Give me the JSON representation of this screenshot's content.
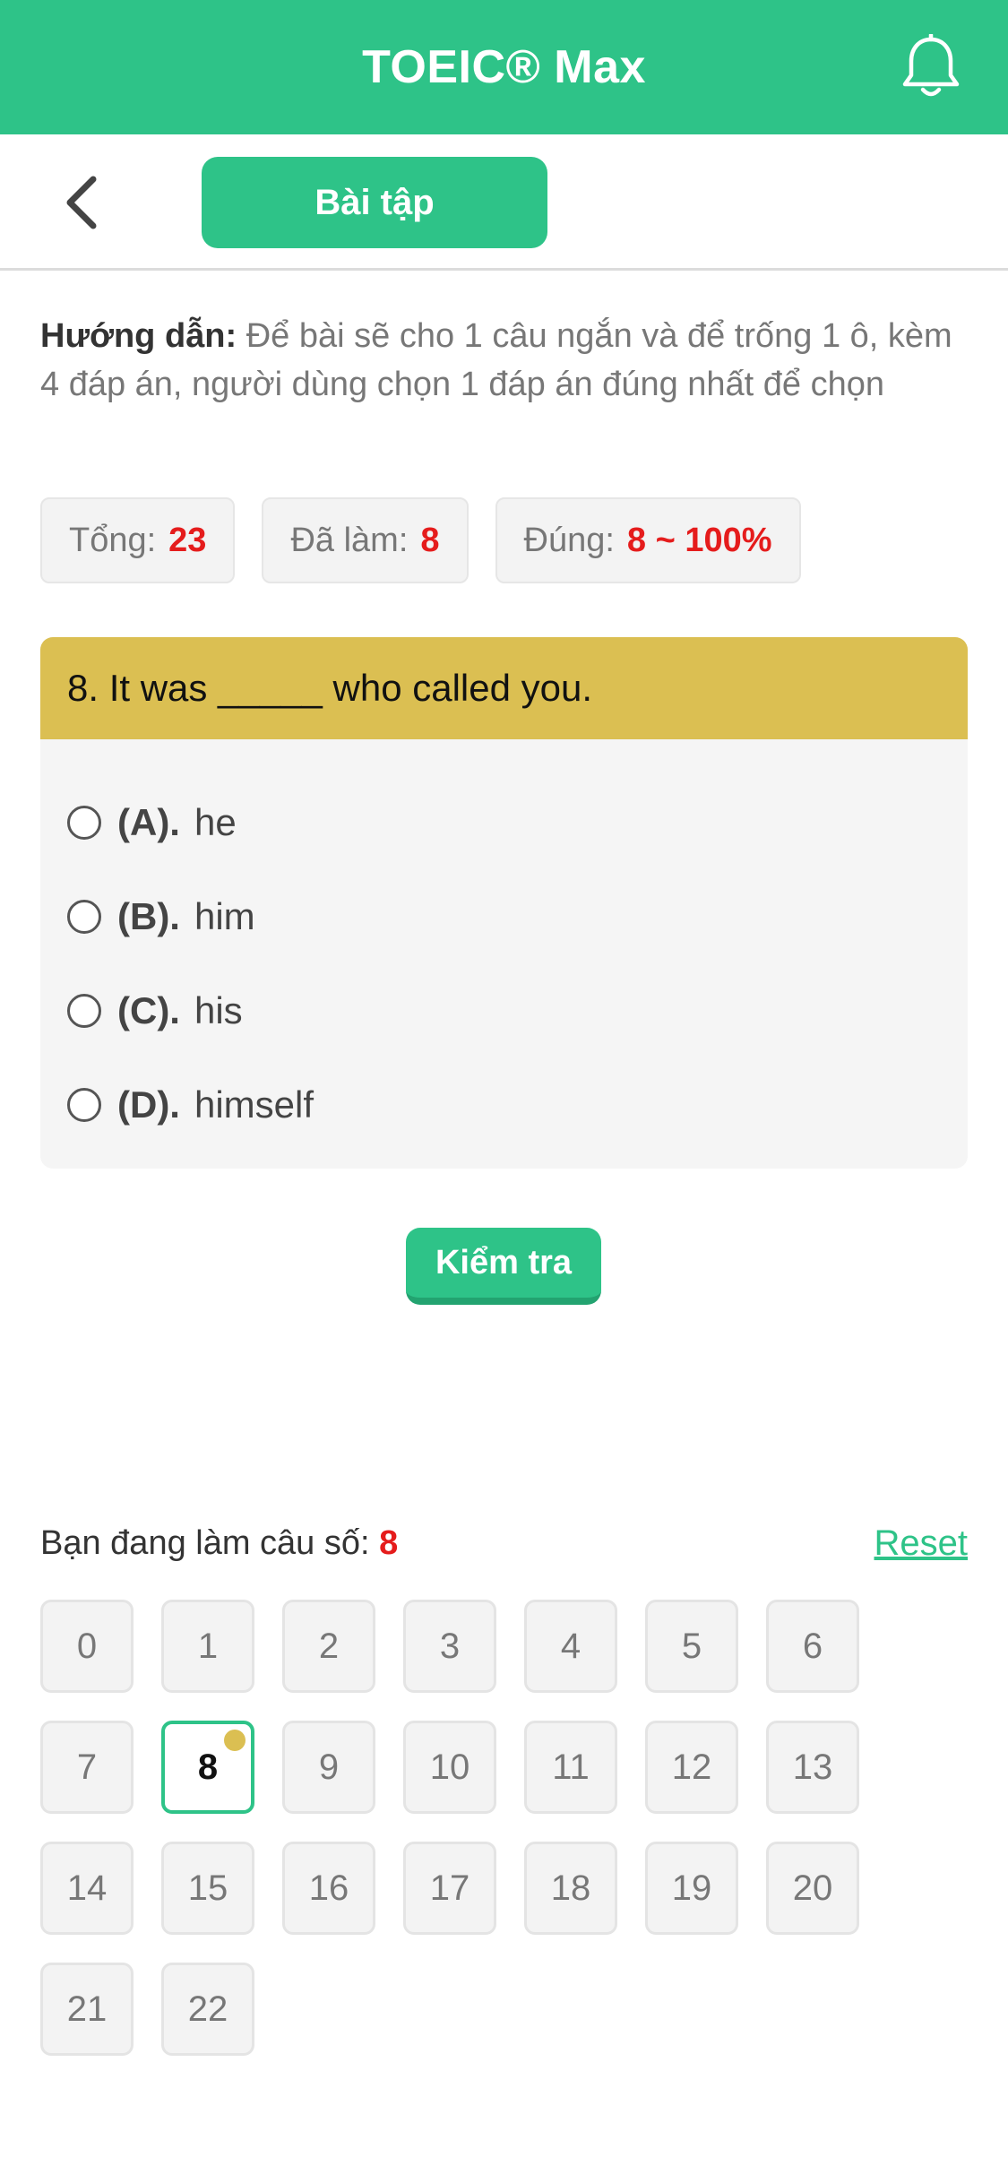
{
  "header": {
    "title": "TOEIC® Max",
    "icons": {
      "notification": "bell-icon"
    },
    "color": "#2ec388"
  },
  "subheader": {
    "back_icon": "chevron-left-icon",
    "tab_label": "Bài tập"
  },
  "instructions": {
    "label": "Hướng dẫn:",
    "text": "Để bài sẽ cho 1 câu ngắn và để trống 1 ô, kèm 4 đáp án, người dùng chọn 1 đáp án đúng nhất để chọn"
  },
  "stats": {
    "total_label": "Tổng:",
    "total_value": "23",
    "done_label": "Đã làm:",
    "done_value": "8",
    "correct_label": "Đúng:",
    "correct_value": "8 ~ 100%"
  },
  "question": {
    "text": "8. It was _____ who called you.",
    "header_color": "#dbbf52",
    "options": [
      {
        "letter": "(A).",
        "text": "he"
      },
      {
        "letter": "(B).",
        "text": "him"
      },
      {
        "letter": "(C).",
        "text": "his"
      },
      {
        "letter": "(D).",
        "text": "himself"
      }
    ]
  },
  "check_button": {
    "label": "Kiểm tra"
  },
  "progress": {
    "label": "Bạn đang làm câu số:",
    "current": "8",
    "reset_label": "Reset"
  },
  "grid": {
    "items": [
      "0",
      "1",
      "2",
      "3",
      "4",
      "5",
      "6",
      "7",
      "8",
      "9",
      "10",
      "11",
      "12",
      "13",
      "14",
      "15",
      "16",
      "17",
      "18",
      "19",
      "20",
      "21",
      "22"
    ],
    "active_index": 8
  }
}
